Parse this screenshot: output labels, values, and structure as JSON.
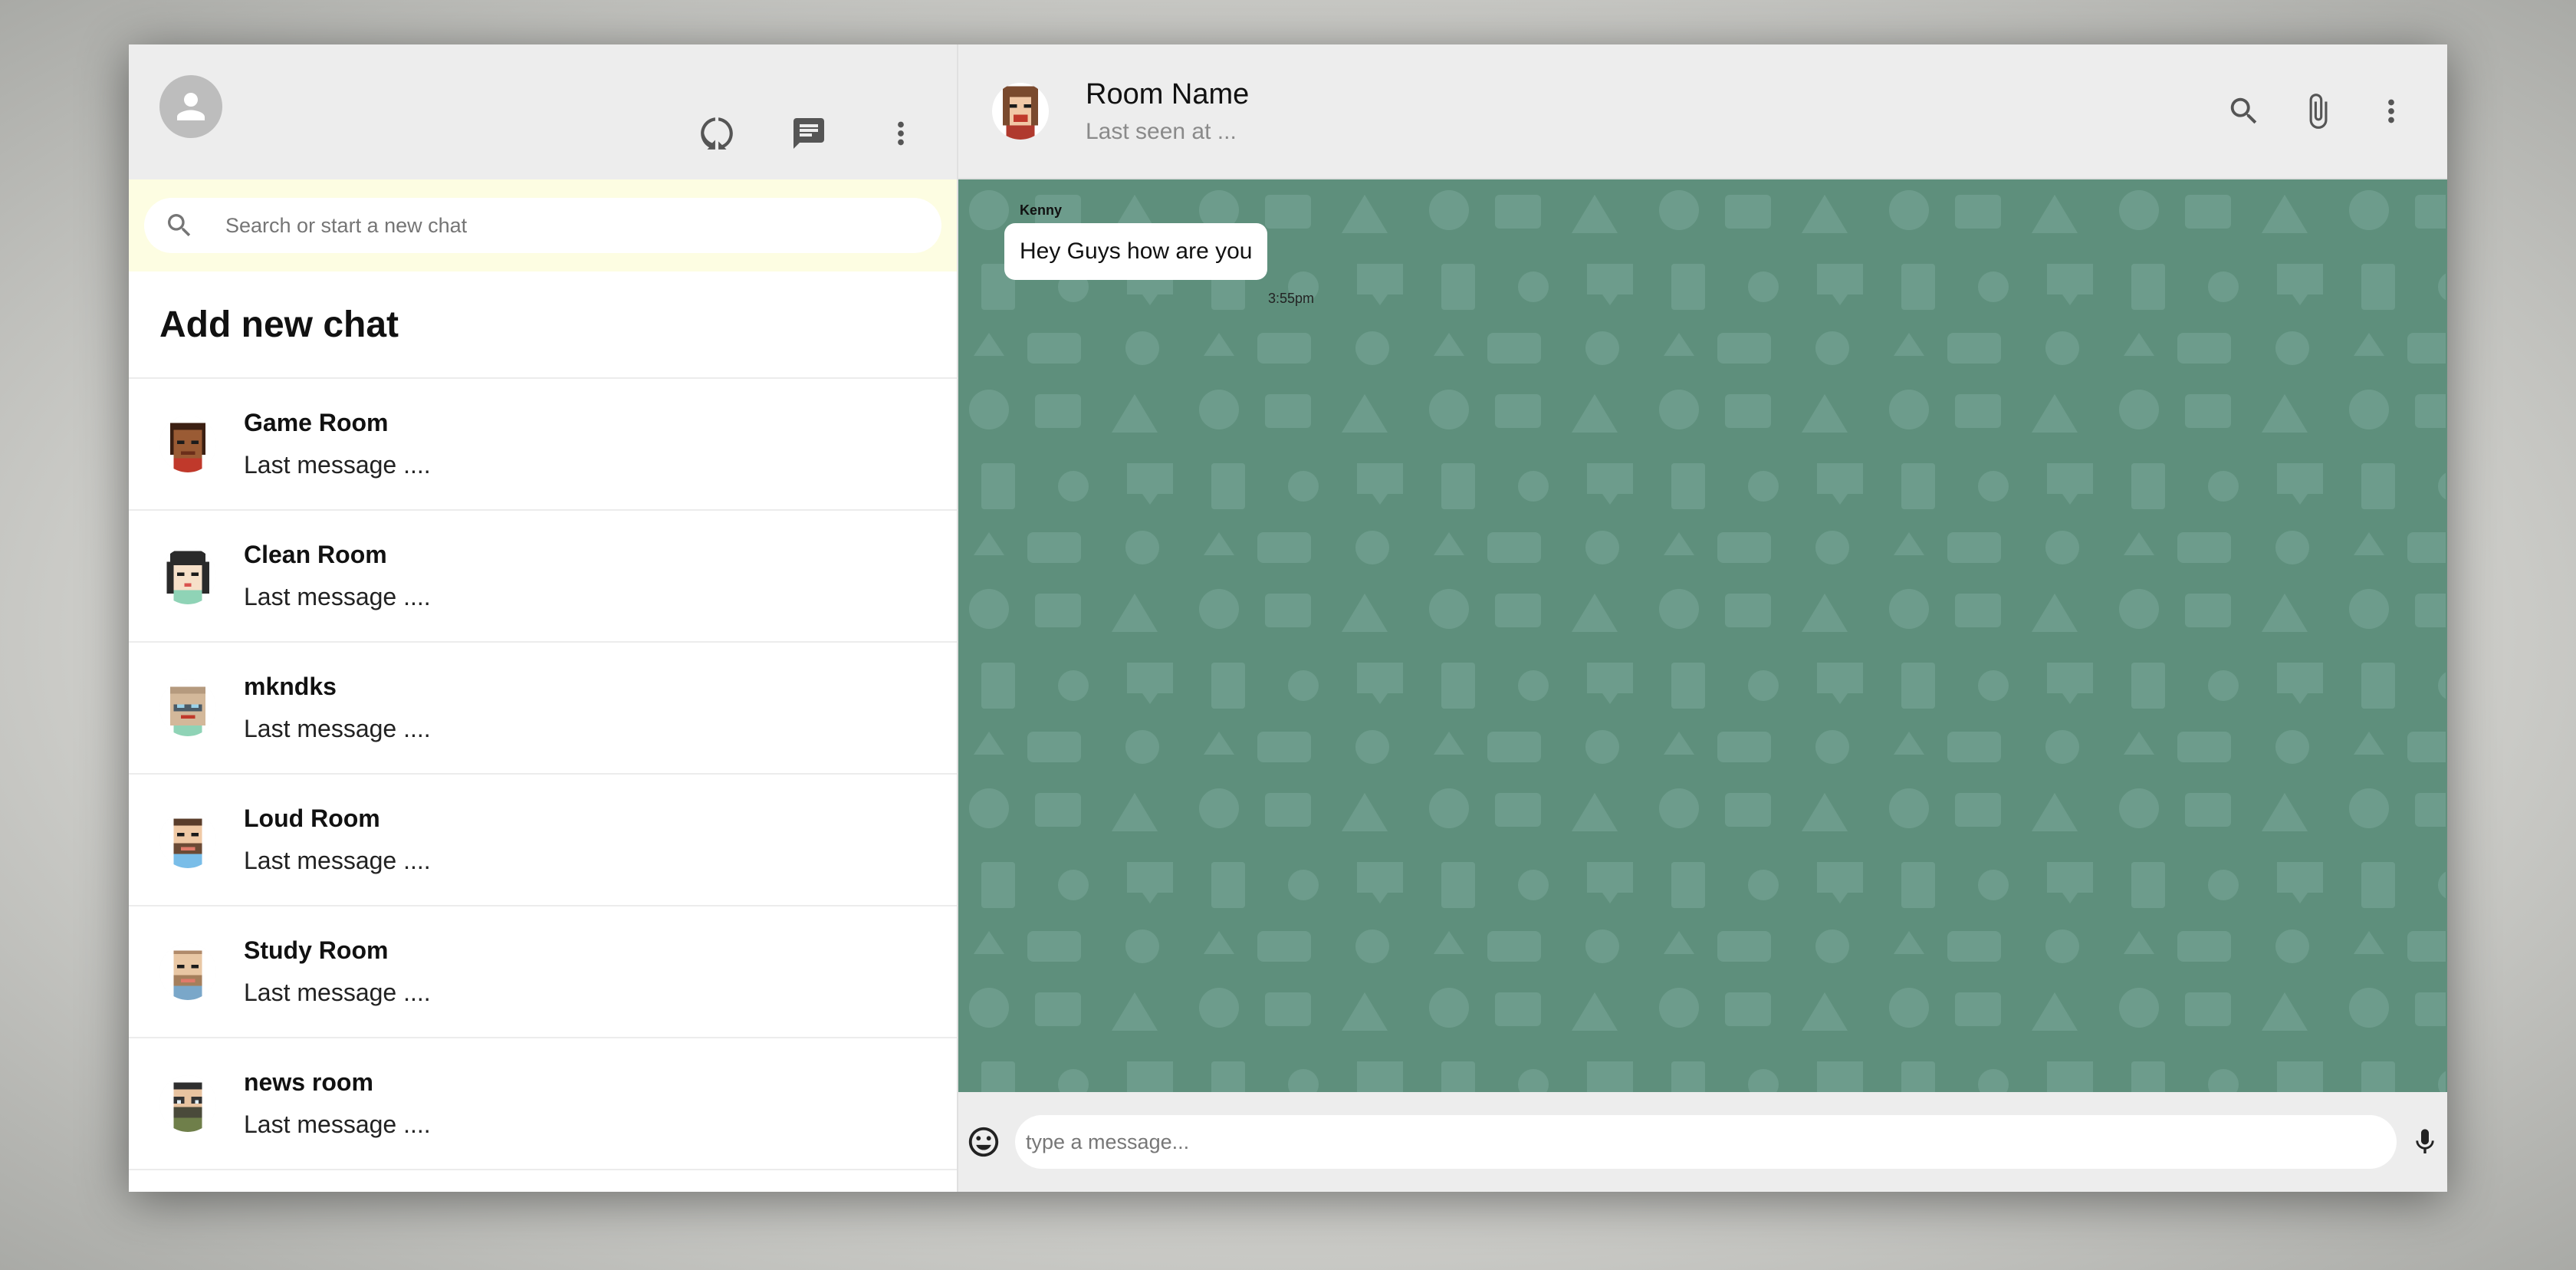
{
  "sidebar": {
    "search_placeholder": "Search or start a new chat",
    "add_new_chat": "Add new chat",
    "chats": [
      {
        "name": "Game Room",
        "last": "Last message ...."
      },
      {
        "name": "Clean Room",
        "last": "Last message ...."
      },
      {
        "name": "mkndks",
        "last": "Last message ...."
      },
      {
        "name": "Loud Room",
        "last": "Last message ...."
      },
      {
        "name": "Study Room",
        "last": "Last message ...."
      },
      {
        "name": "news room",
        "last": "Last message ...."
      }
    ]
  },
  "chat": {
    "room_name": "Room Name",
    "last_seen": "Last seen at ...",
    "messages": [
      {
        "sender": "Kenny",
        "text": "Hey Guys how are you",
        "time": "3:55pm"
      }
    ],
    "input_placeholder": "type a message..."
  },
  "icons": {
    "sidebar_header": [
      "user-avatar-icon",
      "status-icon",
      "chat-icon",
      "more-vert-icon"
    ],
    "chat_header": [
      "search-icon",
      "attach-icon",
      "more-vert-icon"
    ],
    "footer": [
      "emoji-icon",
      "mic-icon"
    ]
  },
  "colors": {
    "header_bg": "#ededed",
    "search_bar_bg": "#fdfde2",
    "chat_bg": "#5e8f7c",
    "bubble_bg": "#ffffff"
  }
}
